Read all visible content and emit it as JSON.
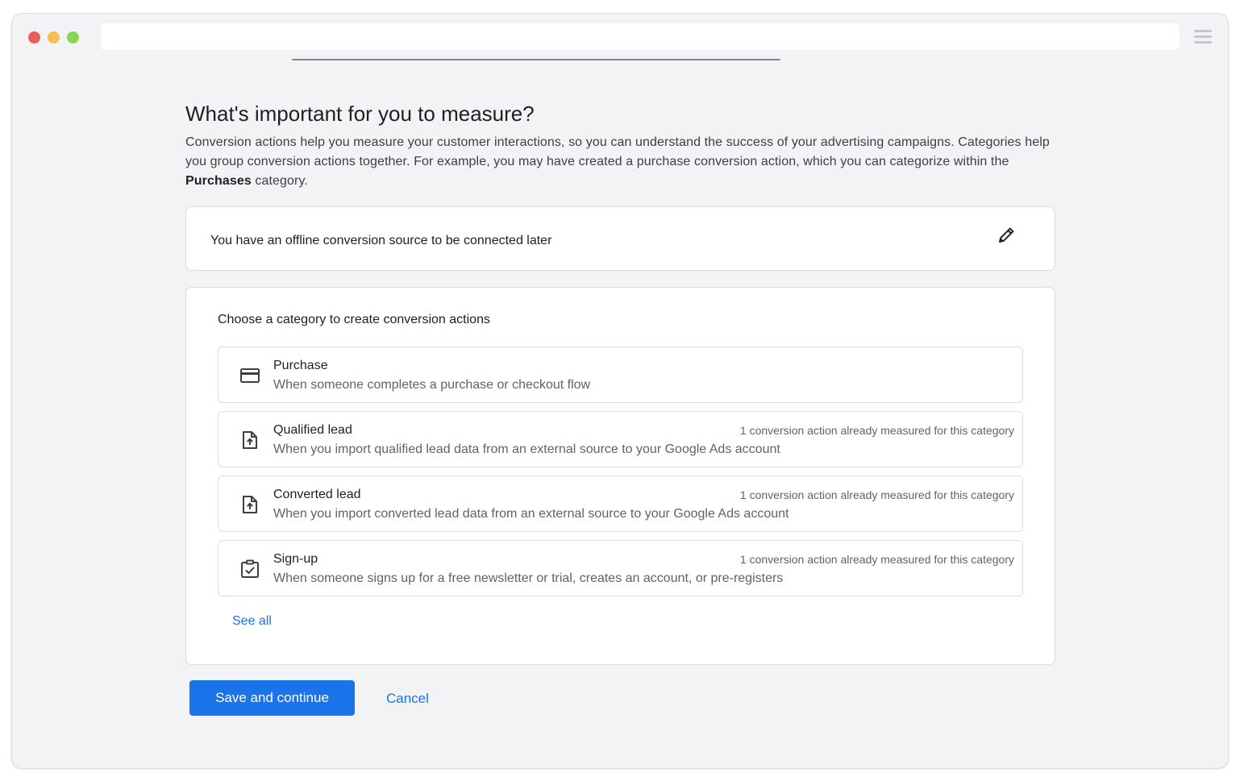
{
  "browser": {
    "colors": {
      "close": "#ed5e5a",
      "minimize": "#f4bf4f",
      "maximize": "#8bd553"
    },
    "menu_icon": "hamburger-menu-icon"
  },
  "page": {
    "title": "What's important for you to measure?",
    "intro_part1": "Conversion actions help you measure your customer interactions, so you can understand the success of your advertising campaigns. Categories help you group conversion actions together. For example, you may have created a purchase conversion action, which you can categorize within the ",
    "intro_bold": "Purchases",
    "intro_part2": " category."
  },
  "source_card": {
    "text": "You have an offline conversion source to be connected later",
    "edit_icon": "pencil-icon"
  },
  "categories": {
    "heading": "Choose a category to create conversion actions",
    "items": [
      {
        "icon": "credit-card-icon",
        "title": "Purchase",
        "description": "When someone completes a purchase or checkout flow",
        "note": ""
      },
      {
        "icon": "file-upload-icon",
        "title": "Qualified lead",
        "description": "When you import qualified lead data from an external source to your Google Ads account",
        "note": "1 conversion action already measured for this category"
      },
      {
        "icon": "file-upload-icon",
        "title": "Converted lead",
        "description": "When you import converted lead data from an external source to your Google Ads account",
        "note": "1 conversion action already measured for this category"
      },
      {
        "icon": "clipboard-check-icon",
        "title": "Sign-up",
        "description": "When someone signs up for a free newsletter or trial, creates an account, or pre-registers",
        "note": "1 conversion action already measured for this category"
      }
    ],
    "see_all": "See all"
  },
  "actions": {
    "primary": "Save and continue",
    "secondary": "Cancel",
    "accent_color": "#1a73e8"
  }
}
